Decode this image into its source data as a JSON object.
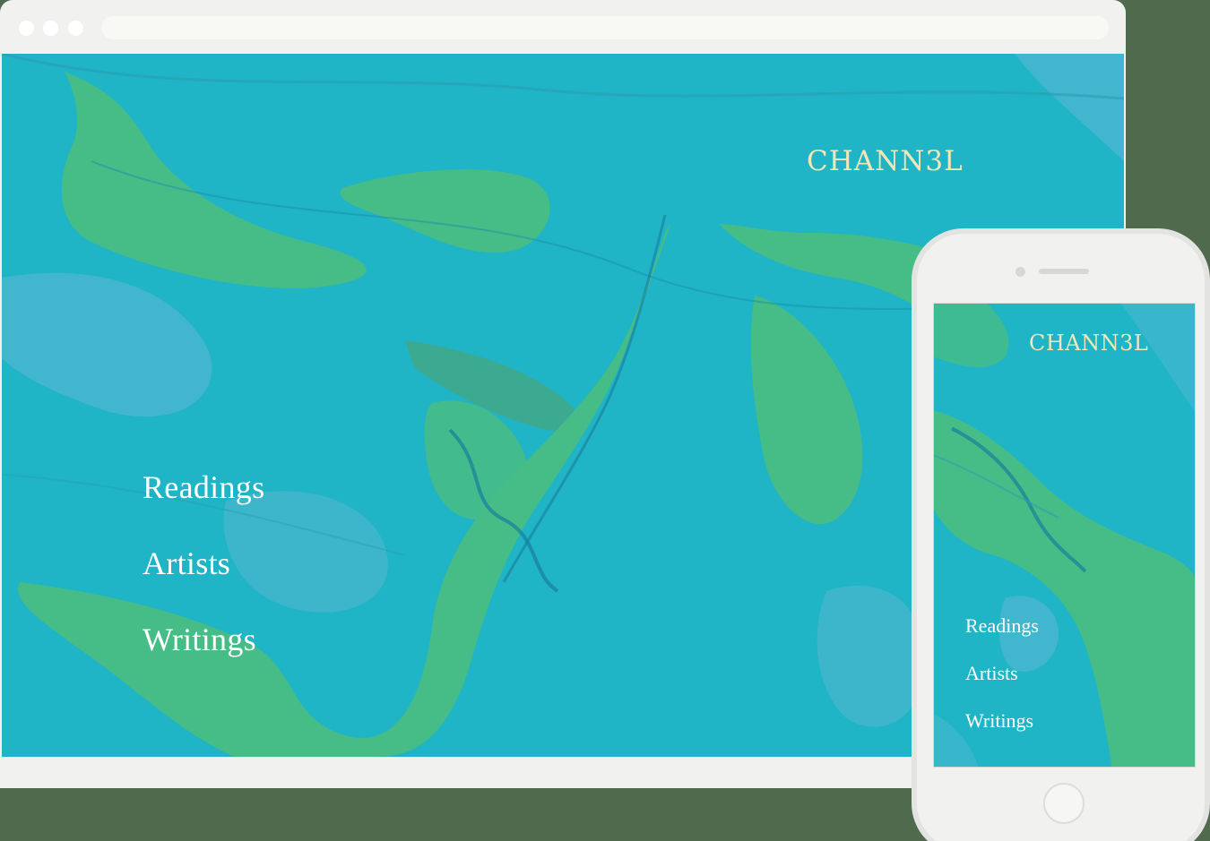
{
  "brand": {
    "logo_text": "CHANN3L"
  },
  "colors": {
    "teal": "#1fb4c6",
    "green": "#46bd86",
    "pale_blue": "#4ab7cf",
    "logo": "#efe7b8"
  },
  "desktop": {
    "nav": [
      {
        "label": "Readings"
      },
      {
        "label": "Artists"
      },
      {
        "label": "Writings"
      }
    ]
  },
  "mobile": {
    "nav": [
      {
        "label": "Readings"
      },
      {
        "label": "Artists"
      },
      {
        "label": "Writings"
      }
    ]
  }
}
